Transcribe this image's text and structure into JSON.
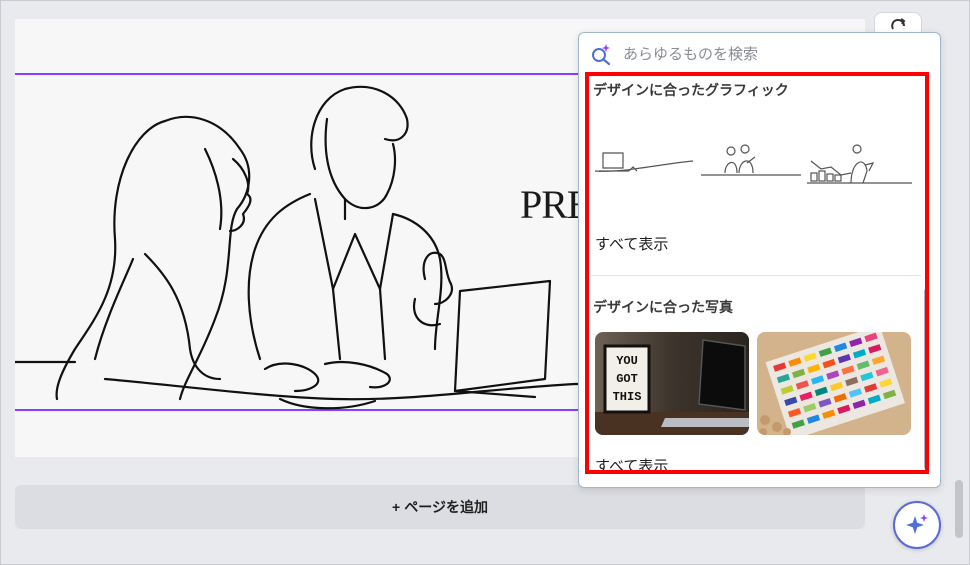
{
  "canvas": {
    "title_partial": "PRE"
  },
  "add_page": {
    "plus": "+",
    "label": "ページを追加"
  },
  "panel": {
    "search": {
      "placeholder": "あらゆるものを検索",
      "icon": "magic-search-icon"
    },
    "graphics": {
      "title": "デザインに合ったグラフィック",
      "items": [
        "laptop-on-desk-line-art",
        "people-meeting-line-art",
        "presenter-chart-line-art"
      ],
      "show_all": "すべて表示"
    },
    "photos": {
      "title": "デザインに合った写真",
      "items": [
        {
          "name": "you-got-this-lightbox-photo",
          "sign_lines": [
            "YOU",
            "GOT",
            "THIS"
          ]
        },
        {
          "name": "colored-threads-photo"
        }
      ],
      "show_all": "すべて表示"
    },
    "highlight_color": "#ff0000"
  },
  "magic_button": {
    "icon": "sparkle-icon"
  },
  "colors": {
    "selection": "#8b3dff",
    "accent": "#5a6ad8"
  }
}
